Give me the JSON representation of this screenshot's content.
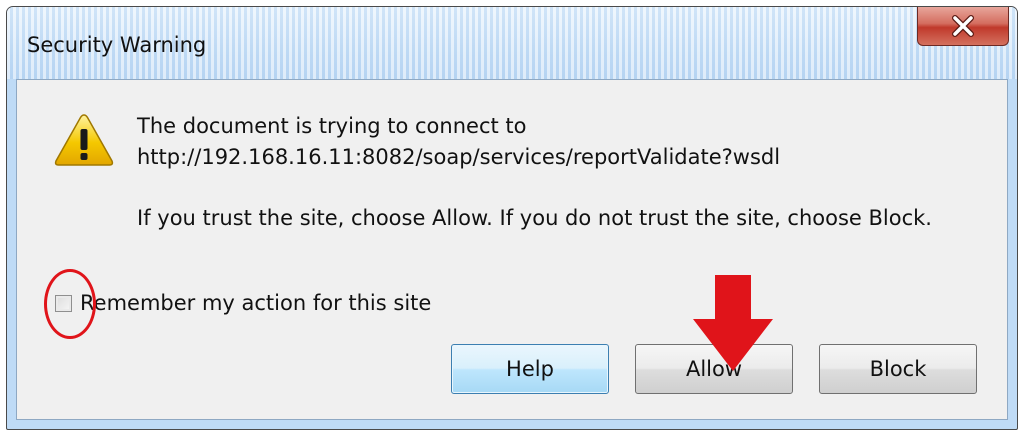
{
  "dialog": {
    "title": "Security Warning"
  },
  "message": {
    "line1": "The document is trying to connect to",
    "line2": "http://192.168.16.11:8082/soap/services/reportValidate?wsdl",
    "line3": "If you trust the site, choose Allow. If you do not trust the site, choose Block."
  },
  "remember": {
    "label": "Remember my action for this site",
    "checked": false
  },
  "buttons": {
    "help": "Help",
    "allow": "Allow",
    "block": "Block"
  },
  "icons": {
    "warning": "warning-icon",
    "close": "close-icon"
  },
  "colors": {
    "annotation_red": "#e0141a",
    "warning_yellow": "#f2c200"
  }
}
